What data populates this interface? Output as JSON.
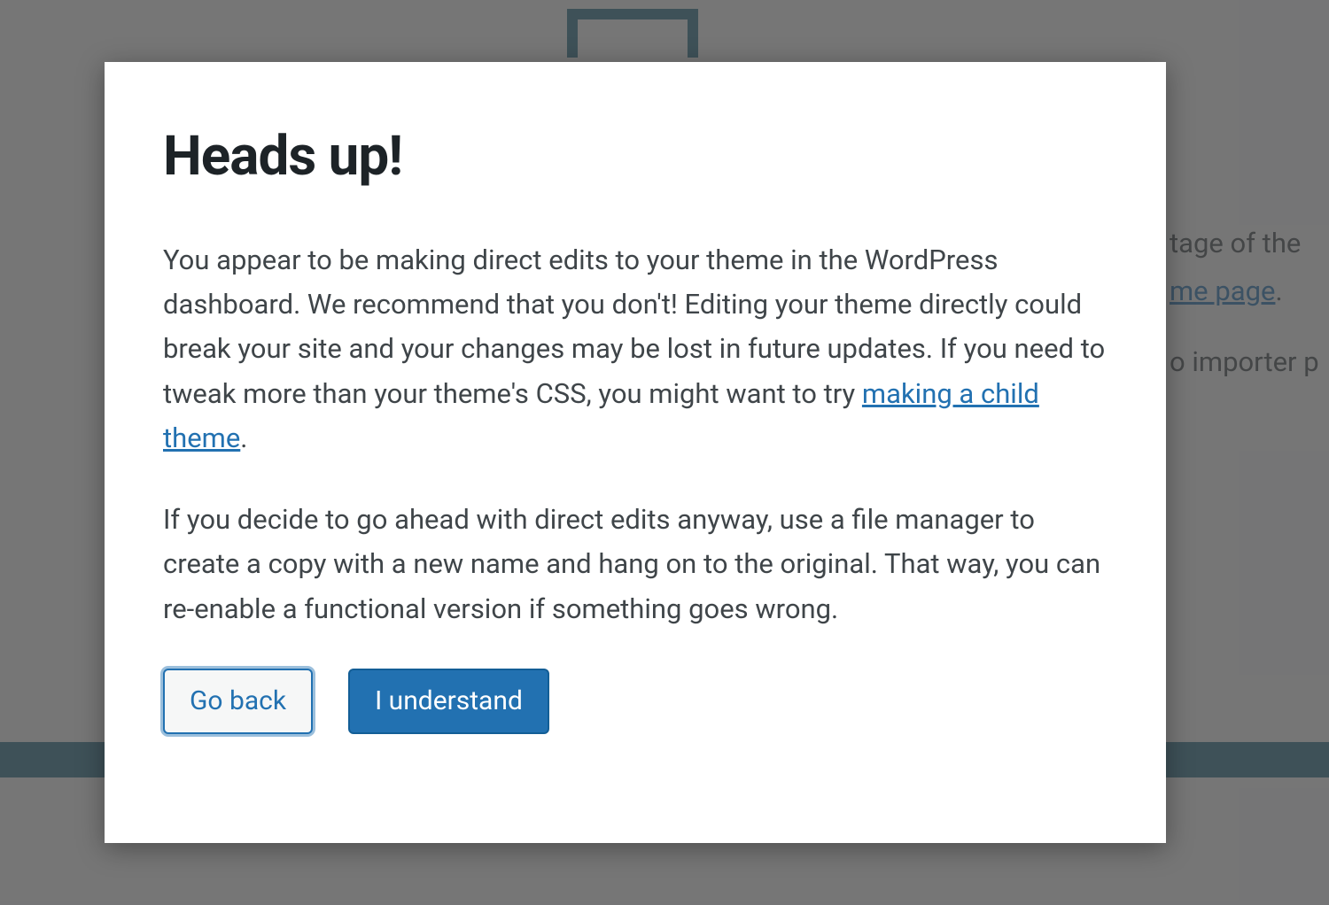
{
  "background": {
    "text_fragment_1": "tage of the",
    "link_fragment_1": "me page",
    "text_fragment_1_suffix": ".",
    "text_fragment_2": "o importer p"
  },
  "modal": {
    "title": "Heads up!",
    "paragraph1_before_link": "You appear to be making direct edits to your theme in the WordPress dashboard. We recommend that you don't! Editing your theme directly could break your site and your changes may be lost in future updates. If you need to tweak more than your theme's CSS, you might want to try ",
    "link_text": "making a child theme",
    "paragraph1_after_link": ".",
    "paragraph2": "If you decide to go ahead with direct edits anyway, use a file manager to create a copy with a new name and hang on to the original. That way, you can re-enable a functional version if something goes wrong.",
    "go_back_label": "Go back",
    "understand_label": "I understand"
  }
}
